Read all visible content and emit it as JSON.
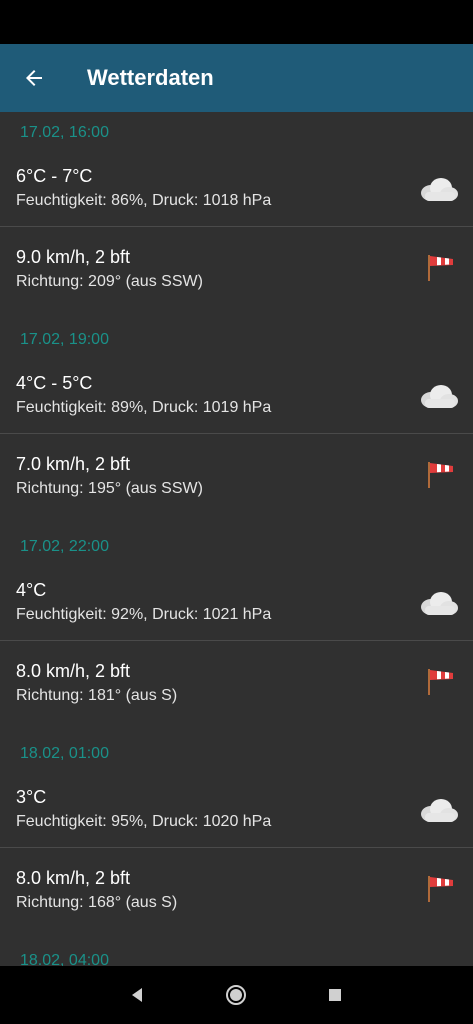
{
  "app_bar": {
    "title": "Wetterdaten",
    "back_icon": "arrow-back-icon",
    "color": "#1f5b78"
  },
  "colors": {
    "background": "#303030",
    "group_header": "#1a9189",
    "divider": "#4a4a4a"
  },
  "groups": [
    {
      "header": "17.02, 16:00",
      "temp": {
        "title": "6°C - 7°C",
        "sub": "Feuchtigkeit: 86%, Druck: 1018 hPa",
        "icon": "cloud-icon"
      },
      "wind": {
        "title": "9.0 km/h, 2 bft",
        "sub": "Richtung: 209° (aus SSW)",
        "icon": "windsock-icon"
      }
    },
    {
      "header": "17.02, 19:00",
      "temp": {
        "title": "4°C - 5°C",
        "sub": "Feuchtigkeit: 89%, Druck: 1019 hPa",
        "icon": "cloud-icon"
      },
      "wind": {
        "title": "7.0 km/h, 2 bft",
        "sub": "Richtung: 195° (aus SSW)",
        "icon": "windsock-icon"
      }
    },
    {
      "header": "17.02, 22:00",
      "temp": {
        "title": "4°C",
        "sub": "Feuchtigkeit: 92%, Druck: 1021 hPa",
        "icon": "cloud-icon"
      },
      "wind": {
        "title": "8.0 km/h, 2 bft",
        "sub": "Richtung: 181° (aus S)",
        "icon": "windsock-icon"
      }
    },
    {
      "header": "18.02, 01:00",
      "temp": {
        "title": "3°C",
        "sub": "Feuchtigkeit: 95%, Druck: 1020 hPa",
        "icon": "cloud-icon"
      },
      "wind": {
        "title": "8.0 km/h, 2 bft",
        "sub": "Richtung: 168° (aus S)",
        "icon": "windsock-icon"
      }
    },
    {
      "header": "18.02, 04:00"
    }
  ],
  "nav_bar": {
    "back_icon": "nav-back-icon",
    "home_icon": "nav-home-icon",
    "recents_icon": "nav-recents-icon"
  }
}
